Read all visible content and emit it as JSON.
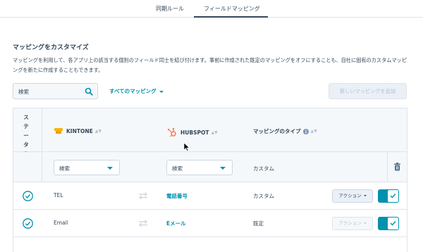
{
  "tabs": [
    {
      "label": "同期ルール",
      "active": false
    },
    {
      "label": "フィールドマッピング",
      "active": true
    }
  ],
  "section": {
    "title": "マッピングをカスタマイズ",
    "description": "マッピングを利用して、各アプリ上の該当する個別のフィールド同士を結び付けます。事前に作成された既定のマッピングをオフにすることも、自社に固有のカスタムマッピングを新たに作成することもできます。"
  },
  "toolbar": {
    "search_placeholder": "検索",
    "filter_label": "すべてのマッピング",
    "add_button_label": "新しいマッピングを追加"
  },
  "table": {
    "headers": {
      "status": "ステータス",
      "kintone": "KINTONE",
      "hubspot": "HUBSPOT",
      "type": "マッピングのタイプ"
    },
    "filters": {
      "kintone": "検索",
      "hubspot": "検索",
      "type": "カスタム"
    },
    "rows": [
      {
        "kintone": "TEL",
        "hubspot": "電話番号",
        "type": "カスタム",
        "action": "アクション",
        "action_enabled": true,
        "enabled": true
      },
      {
        "kintone": "Email",
        "hubspot": "Eメール",
        "type": "既定",
        "action": "アクション",
        "action_enabled": false,
        "enabled": true
      }
    ]
  },
  "colors": {
    "accent": "#0091ae",
    "text": "#33475b",
    "border": "#dfe3eb",
    "header_bg": "#f5f8fa",
    "hubspot_orange": "#ff7a59"
  }
}
